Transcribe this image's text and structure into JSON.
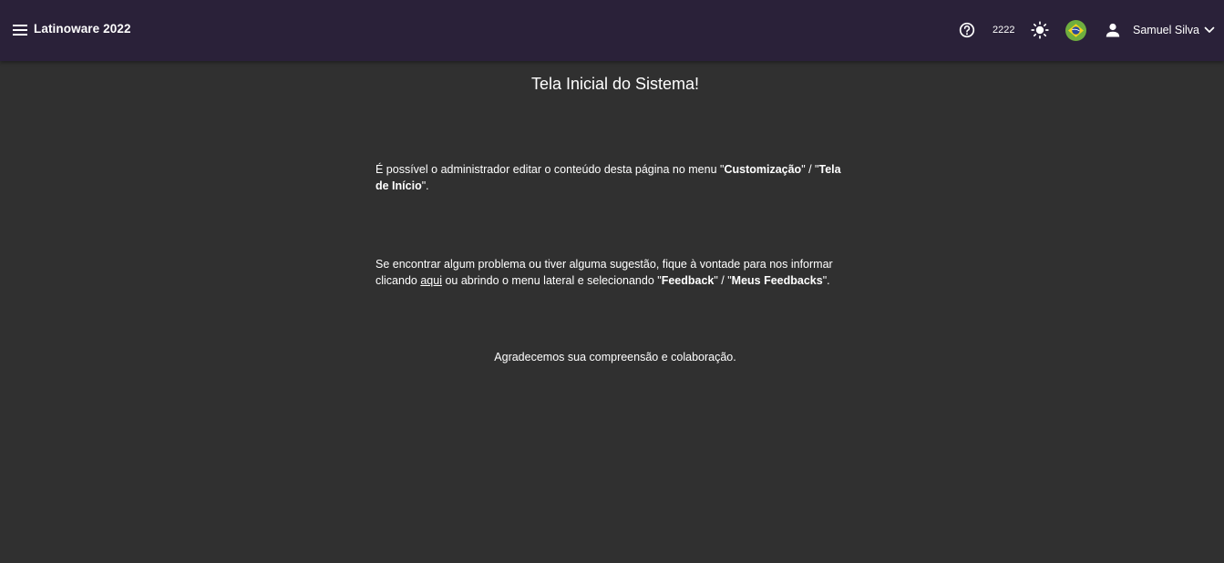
{
  "header": {
    "app_title": "Latinoware 2022",
    "counter": "2222",
    "user_name": "Samuel Silva",
    "icons": {
      "menu": "menu-icon",
      "help": "help-icon",
      "theme": "sun-icon",
      "language": "brazil-flag-icon",
      "user": "person-icon",
      "dropdown": "chevron-down-icon"
    }
  },
  "main": {
    "title": "Tela Inicial do Sistema!",
    "paragraph1": {
      "text_a": "É possível o administrador editar o conteúdo desta página no menu ",
      "quote1": "\"",
      "strong1": "Customização",
      "mid": "\" / \"",
      "strong2": "Tela de Início",
      "end": "\"."
    },
    "paragraph2": {
      "text_a": "Se encontrar algum problema ou tiver alguma sugestão, fique à vontade para nos informar clicando ",
      "link": "aqui",
      "text_b": " ou abrindo o menu lateral e selecionando ",
      "quote1": "\"",
      "strong1": "Feedback",
      "mid": "\" / \"",
      "strong2": "Meus Feedbacks",
      "end": "\"."
    },
    "thanks": "Agradecemos sua compreensão e colaboração."
  },
  "colors": {
    "topbar": "#2a2139",
    "background": "#303030",
    "text": "#ffffff",
    "flag_green": "#6fae3f",
    "flag_yellow": "#f3d31c",
    "flag_blue": "#2b4a9b"
  }
}
